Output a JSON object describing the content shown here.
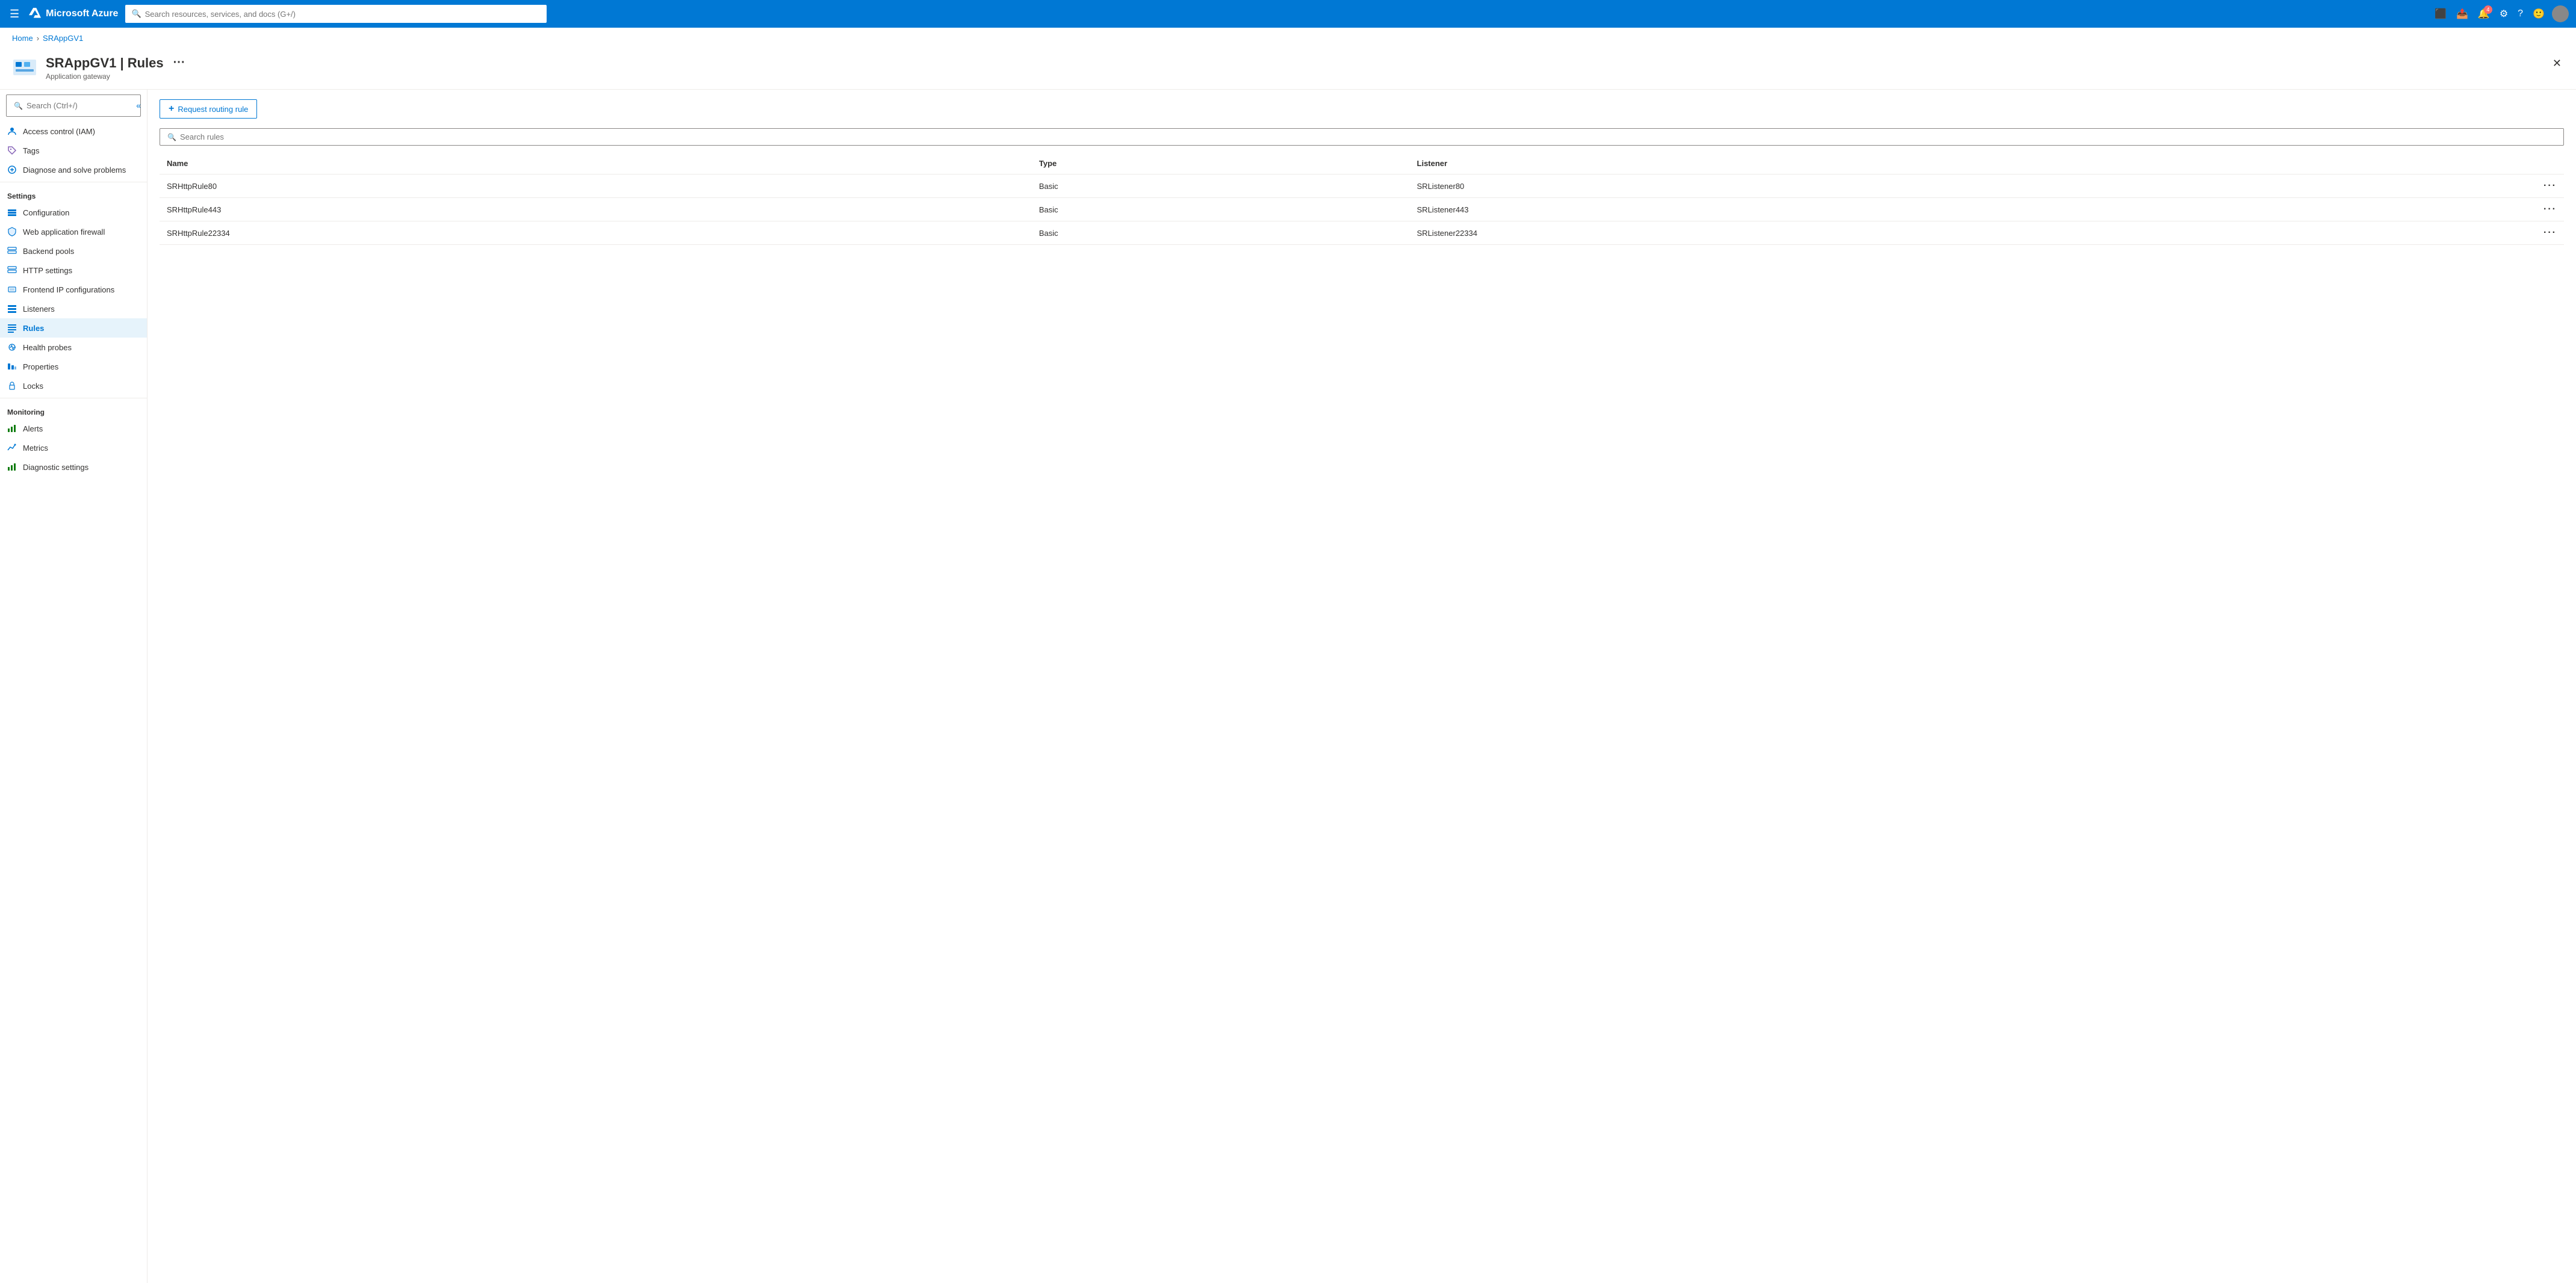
{
  "topbar": {
    "logo_text": "Microsoft Azure",
    "search_placeholder": "Search resources, services, and docs (G+/)",
    "notification_count": "4"
  },
  "breadcrumb": {
    "home": "Home",
    "current": "SRAppGV1"
  },
  "page_header": {
    "title": "SRAppGV1 | Rules",
    "subtitle": "Application gateway",
    "ellipsis": "···"
  },
  "sidebar": {
    "search_placeholder": "Search (Ctrl+/)",
    "items": [
      {
        "id": "access-control",
        "label": "Access control (IAM)",
        "icon": "👤"
      },
      {
        "id": "tags",
        "label": "Tags",
        "icon": "🏷"
      },
      {
        "id": "diagnose",
        "label": "Diagnose and solve problems",
        "icon": "🔧"
      }
    ],
    "settings_label": "Settings",
    "settings_items": [
      {
        "id": "configuration",
        "label": "Configuration",
        "icon": "⚙"
      },
      {
        "id": "waf",
        "label": "Web application firewall",
        "icon": "🛡"
      },
      {
        "id": "backend-pools",
        "label": "Backend pools",
        "icon": "☰"
      },
      {
        "id": "http-settings",
        "label": "HTTP settings",
        "icon": "☰"
      },
      {
        "id": "frontend-ip",
        "label": "Frontend IP configurations",
        "icon": "🖥"
      },
      {
        "id": "listeners",
        "label": "Listeners",
        "icon": "☰"
      },
      {
        "id": "rules",
        "label": "Rules",
        "icon": "≡",
        "active": true
      },
      {
        "id": "health-probes",
        "label": "Health probes",
        "icon": "💡"
      },
      {
        "id": "properties",
        "label": "Properties",
        "icon": "📊"
      },
      {
        "id": "locks",
        "label": "Locks",
        "icon": "🔒"
      }
    ],
    "monitoring_label": "Monitoring",
    "monitoring_items": [
      {
        "id": "alerts",
        "label": "Alerts",
        "icon": "📊"
      },
      {
        "id": "metrics",
        "label": "Metrics",
        "icon": "📈"
      },
      {
        "id": "diagnostic-settings",
        "label": "Diagnostic settings",
        "icon": "📊"
      }
    ]
  },
  "content": {
    "add_button_label": "Request routing rule",
    "search_placeholder": "Search rules",
    "table": {
      "columns": [
        "Name",
        "Type",
        "Listener"
      ],
      "rows": [
        {
          "name": "SRHttpRule80",
          "type": "Basic",
          "listener": "SRListener80"
        },
        {
          "name": "SRHttpRule443",
          "type": "Basic",
          "listener": "SRListener443"
        },
        {
          "name": "SRHttpRule22334",
          "type": "Basic",
          "listener": "SRListener22334"
        }
      ]
    }
  }
}
